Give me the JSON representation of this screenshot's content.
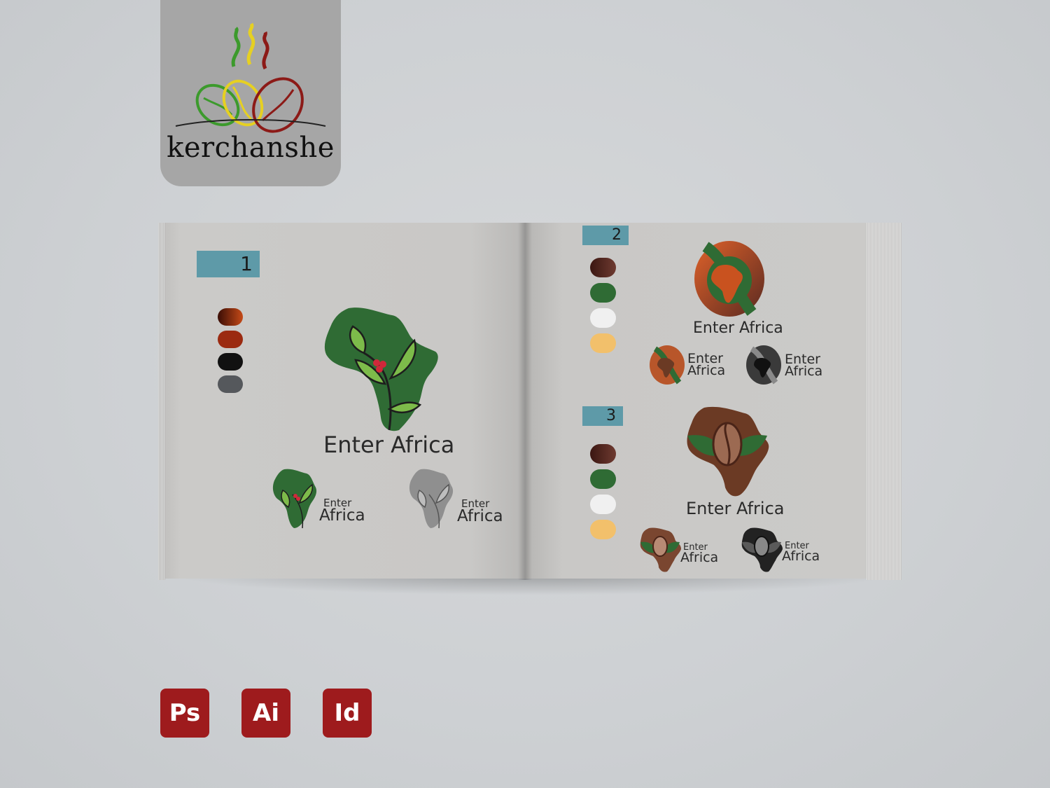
{
  "brand": {
    "name": "kerchanshe"
  },
  "book": {
    "left_page": {
      "section_number": "1",
      "swatches": [
        "#7a2c0e",
        "#9b2a10",
        "#111111",
        "#55585c"
      ],
      "main_logo_text": "Enter Africa",
      "small_logos": [
        {
          "line1": "Enter",
          "line2": "Africa"
        },
        {
          "line1": "Enter",
          "line2": "Africa"
        }
      ]
    },
    "right_page": {
      "section_2": {
        "number": "2",
        "swatches": [
          "#5a2a21",
          "#2f6b34",
          "#f0f0f0",
          "#f2c06b"
        ],
        "main_logo_text": "Enter Africa",
        "small_logos": [
          {
            "line1": "Enter",
            "line2": "Africa"
          },
          {
            "line1": "Enter",
            "line2": "Africa"
          }
        ]
      },
      "section_3": {
        "number": "3",
        "swatches": [
          "#5a2a21",
          "#2f6b34",
          "#f0f0f0",
          "#f2c06b"
        ],
        "main_logo_text": "Enter Africa",
        "small_logos": [
          {
            "line1": "Enter",
            "line2": "Africa"
          },
          {
            "line1": "Enter",
            "line2": "Africa"
          }
        ]
      }
    }
  },
  "software_icons": [
    "Ps",
    "Ai",
    "Id"
  ],
  "colors": {
    "tag": "#5e9aa8",
    "africa_green": "#2f6b34",
    "africa_brown": "#6b3a24",
    "accent_red": "#9e1b1d"
  }
}
